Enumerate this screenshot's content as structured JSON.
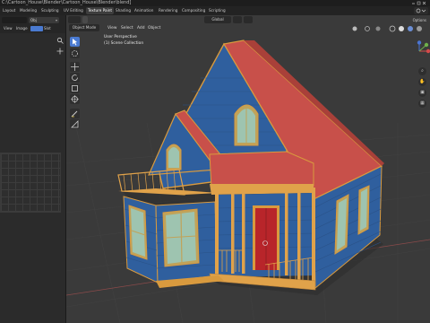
{
  "titlebar": {
    "title": "C:\\Cartoon_House\\Blender\\Cartoon_House\\Blender\\blend]"
  },
  "workspace_tabs": [
    "Layout",
    "Modeling",
    "Sculpting",
    "UV Editing",
    "Texture Paint",
    "Shading",
    "Animation",
    "Rendering",
    "Compositing",
    "Scripting"
  ],
  "active_workspace": "Texture Paint",
  "left_editor": {
    "mode_value": "Obj",
    "view_label": "View",
    "image_label": "Image",
    "slot_label": "Slot"
  },
  "viewport": {
    "mode_label": "Object Mode",
    "menus": [
      "View",
      "Select",
      "Add",
      "Object"
    ],
    "transform_orientation": "Global",
    "overlay_line1": "User Perspective",
    "overlay_line2": "(1) Scene Collection",
    "options_label": "Options",
    "tools": [
      "select-box",
      "cursor",
      "move",
      "rotate",
      "scale",
      "transform",
      "annotate",
      "measure"
    ]
  },
  "colors": {
    "house_wall": "#2f5f9e",
    "house_roof": "#c8504a",
    "house_trim": "#e0a24a",
    "window_glass": "#a7c9b8",
    "door": "#b8252a",
    "accent": "#4a7ad1"
  }
}
